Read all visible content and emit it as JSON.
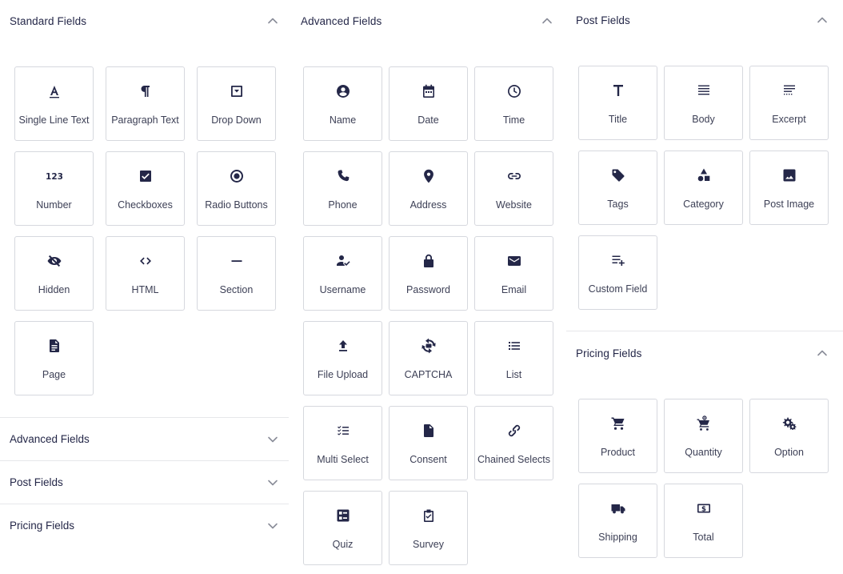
{
  "standard": {
    "title": "Standard Fields",
    "items": [
      {
        "label": "Single Line Text",
        "icon": "text-a-icon"
      },
      {
        "label": "Paragraph Text",
        "icon": "paragraph-icon"
      },
      {
        "label": "Drop Down",
        "icon": "dropdown-icon"
      },
      {
        "label": "Number",
        "icon": "number-icon"
      },
      {
        "label": "Checkboxes",
        "icon": "checkbox-icon"
      },
      {
        "label": "Radio Buttons",
        "icon": "radio-icon"
      },
      {
        "label": "Hidden",
        "icon": "eye-off-icon"
      },
      {
        "label": "HTML",
        "icon": "code-icon"
      },
      {
        "label": "Section",
        "icon": "minus-icon"
      },
      {
        "label": "Page",
        "icon": "document-icon"
      }
    ]
  },
  "collapsed_sections": [
    {
      "title": "Advanced Fields"
    },
    {
      "title": "Post Fields"
    },
    {
      "title": "Pricing Fields"
    }
  ],
  "advanced": {
    "title": "Advanced Fields",
    "items": [
      {
        "label": "Name",
        "icon": "user-circle-icon"
      },
      {
        "label": "Date",
        "icon": "calendar-icon"
      },
      {
        "label": "Time",
        "icon": "clock-icon"
      },
      {
        "label": "Phone",
        "icon": "phone-icon"
      },
      {
        "label": "Address",
        "icon": "map-pin-icon"
      },
      {
        "label": "Website",
        "icon": "link-icon"
      },
      {
        "label": "Username",
        "icon": "user-check-icon"
      },
      {
        "label": "Password",
        "icon": "lock-icon"
      },
      {
        "label": "Email",
        "icon": "envelope-icon"
      },
      {
        "label": "File Upload",
        "icon": "upload-icon"
      },
      {
        "label": "CAPTCHA",
        "icon": "captcha-icon"
      },
      {
        "label": "List",
        "icon": "list-icon"
      },
      {
        "label": "Multi Select",
        "icon": "multi-select-icon"
      },
      {
        "label": "Consent",
        "icon": "file-icon"
      },
      {
        "label": "Chained Selects",
        "icon": "chain-icon"
      },
      {
        "label": "Quiz",
        "icon": "quiz-icon"
      },
      {
        "label": "Survey",
        "icon": "clipboard-check-icon"
      }
    ]
  },
  "post": {
    "title": "Post Fields",
    "items": [
      {
        "label": "Title",
        "icon": "title-t-icon"
      },
      {
        "label": "Body",
        "icon": "align-justify-icon"
      },
      {
        "label": "Excerpt",
        "icon": "excerpt-icon"
      },
      {
        "label": "Tags",
        "icon": "tag-icon"
      },
      {
        "label": "Category",
        "icon": "shapes-icon"
      },
      {
        "label": "Post Image",
        "icon": "image-icon"
      },
      {
        "label": "Custom Field",
        "icon": "playlist-add-icon"
      }
    ]
  },
  "pricing": {
    "title": "Pricing Fields",
    "items": [
      {
        "label": "Product",
        "icon": "cart-icon"
      },
      {
        "label": "Quantity",
        "icon": "cart-add-icon"
      },
      {
        "label": "Option",
        "icon": "gears-icon"
      },
      {
        "label": "Shipping",
        "icon": "truck-icon"
      },
      {
        "label": "Total",
        "icon": "dollar-bill-icon"
      }
    ]
  }
}
